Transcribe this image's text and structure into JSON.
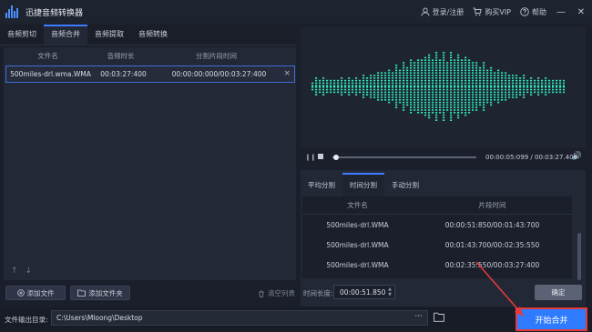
{
  "app": {
    "title": "迅捷音频转换器"
  },
  "titlebar": {
    "login": "登录/注册",
    "vip": "购买VIP",
    "help": "帮助"
  },
  "tabs": [
    {
      "label": "音频剪切"
    },
    {
      "label": "音频合并"
    },
    {
      "label": "音频提取"
    },
    {
      "label": "音频转换"
    }
  ],
  "file_table": {
    "headers": [
      "文件名",
      "音频时长",
      "分割片段时间"
    ],
    "rows": [
      {
        "name": "500miles-drl.wma.WMA",
        "duration": "00:03:27:400",
        "segment": "00:00:00:000/00:03:27:400"
      }
    ]
  },
  "left_actions": {
    "add_file": "添加文件",
    "add_folder": "添加文件夹",
    "clear": "清空列表"
  },
  "player": {
    "current": "00:00:05:099",
    "separator": "/",
    "total": "00:03:27.400",
    "progress": 0.025
  },
  "split_tabs": [
    {
      "label": "平均分割"
    },
    {
      "label": "时间分割"
    },
    {
      "label": "手动分割"
    }
  ],
  "split_table": {
    "headers": [
      "文件名",
      "片段时间"
    ],
    "rows": [
      {
        "name": "500miles-drl.WMA",
        "segment": "00:00:51:850/00:01:43:700"
      },
      {
        "name": "500miles-drl.WMA",
        "segment": "00:01:43:700/00:02:35:550"
      },
      {
        "name": "500miles-drl.WMA",
        "segment": "00:02:35:550/00:03:27:400"
      }
    ]
  },
  "duration": {
    "label": "时间长度:",
    "value": "00:00:51.850"
  },
  "confirm_label": "确定",
  "output": {
    "label": "文件输出目录:",
    "path": "C:\\Users\\Mloong\\Desktop",
    "more": "···"
  },
  "start_label": "开始合并",
  "colors": {
    "accent": "#2f7bff",
    "wave": "#2ee6b8",
    "highlight": "#e53a3a"
  }
}
